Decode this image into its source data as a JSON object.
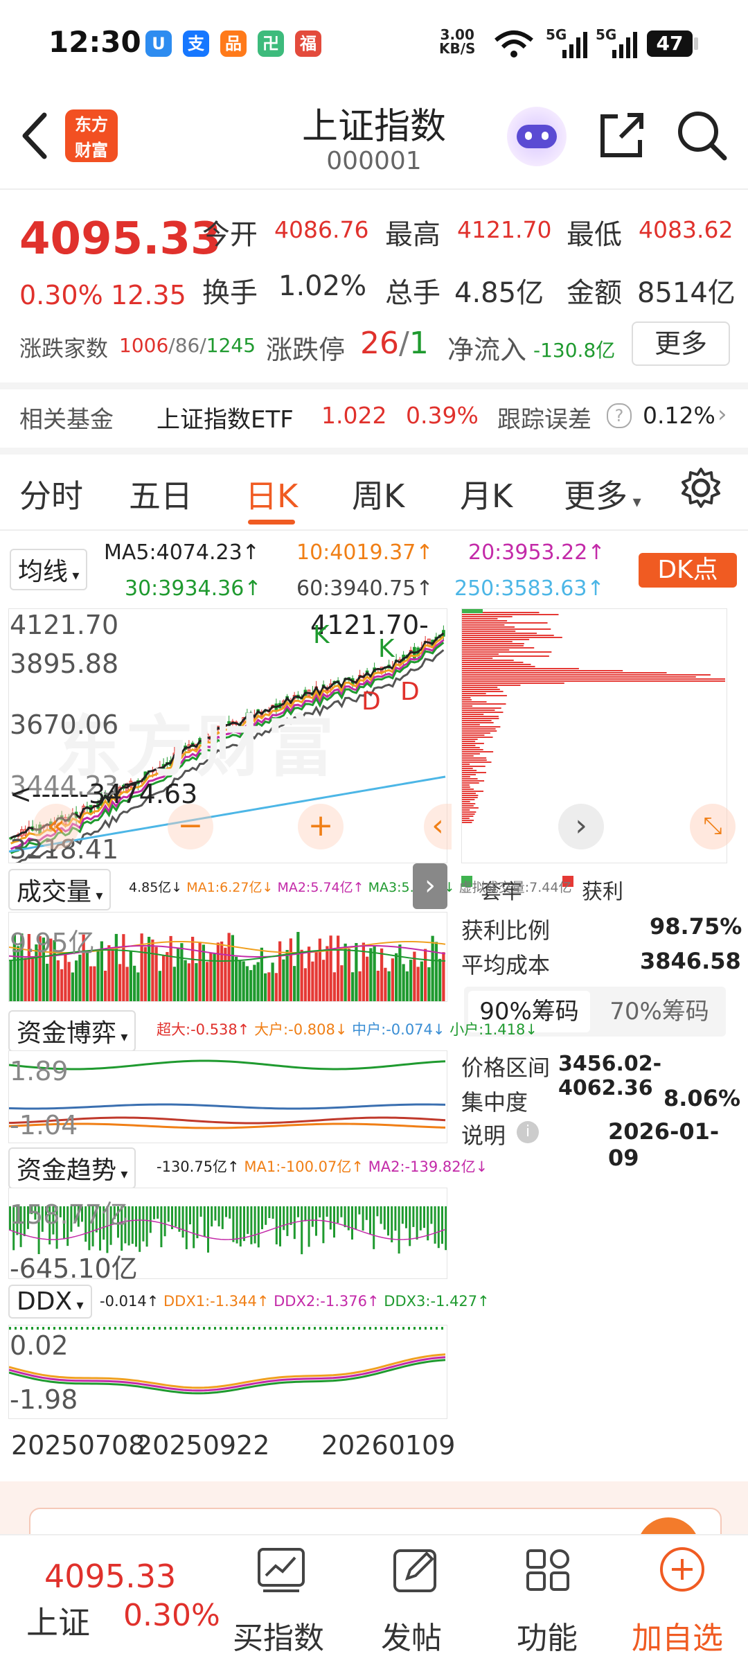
{
  "status": {
    "time": "12:30",
    "net_speed": "3.00\nKB/S",
    "signal": [
      "5G",
      "5G"
    ],
    "battery": "47",
    "apps": [
      {
        "icon": "app-blue-icon",
        "glyph": "U",
        "color": "#2d8cf0"
      },
      {
        "icon": "alipay-icon",
        "glyph": "支",
        "color": "#1677ff"
      },
      {
        "icon": "orange-app-icon",
        "glyph": "品",
        "color": "#ff7a1a"
      },
      {
        "icon": "green-app-icon",
        "glyph": "卍",
        "color": "#3dbb7c"
      },
      {
        "icon": "red-app-icon",
        "glyph": "福",
        "color": "#e34b3c"
      }
    ]
  },
  "header": {
    "title": "上证指数",
    "code": "000001",
    "logo_line1": "东方",
    "logo_line2": "财富"
  },
  "quote": {
    "price": "4095.33",
    "change_pct": "0.30%",
    "change": "12.35",
    "open_label": "今开",
    "open": "4086.76",
    "high_label": "最高",
    "high": "4121.70",
    "low_label": "最低",
    "low": "4083.62",
    "turnover_label": "换手",
    "turnover": "1.02%",
    "volume_label": "总手",
    "volume": "4.85亿",
    "amount_label": "金额",
    "amount": "8514亿",
    "breadth_label": "涨跌家数",
    "breadth_up": "1006",
    "breadth_flat": "86",
    "breadth_down": "1245",
    "limit_label": "涨跌停",
    "limit_up": "26",
    "limit_down": "1",
    "inflow_label": "净流入",
    "inflow": "-130.8亿",
    "more": "更多"
  },
  "fund": {
    "label": "相关基金",
    "name": "上证指数ETF",
    "price": "1.022",
    "pct": "0.39%",
    "tracking_label": "跟踪误差",
    "tracking": "0.12%"
  },
  "tabs": [
    "分时",
    "五日",
    "日K",
    "周K",
    "月K",
    "更多"
  ],
  "active_tab": 2,
  "ma": {
    "selector": "均线",
    "ma5": "MA5:4074.23↑",
    "ma10": "10:4019.37↑",
    "ma20": "20:3953.22↑",
    "ma30": "30:3934.36↑",
    "ma60": "60:3940.75↑",
    "ma250": "250:3583.63↑",
    "dk": "DK点"
  },
  "kline": {
    "price_top": "4121.70",
    "price_2": "3895.88",
    "price_3": "3670.06",
    "price_4": "3444.23",
    "price_bottom": "3218.41",
    "max_label": "4121.70",
    "min_label": "3474.63",
    "markers": [
      "K",
      "K",
      "D",
      "D"
    ],
    "watermark": "东方财富"
  },
  "volume": {
    "selector": "成交量",
    "info": [
      "4.85亿↓",
      "MA1:6.27亿↓",
      "MA2:5.74亿↑",
      "MA3:5.43亿↓",
      "虚拟成交量:7.44亿"
    ],
    "scale": "9.95亿"
  },
  "fund_game": {
    "selector": "资金博弈",
    "info": [
      "超大:-0.538↑",
      "大户:-0.808↓",
      "中户:-0.074↓",
      "小户:1.418↓"
    ],
    "top": "1.89",
    "bottom": "-1.04"
  },
  "fund_trend": {
    "selector": "资金趋势",
    "info": [
      "-130.75亿↑",
      "MA1:-100.07亿↑",
      "MA2:-139.82亿↓"
    ],
    "top": "158.77亿",
    "bottom": "-645.10亿"
  },
  "ddx": {
    "selector": "DDX",
    "info": [
      "-0.014↑",
      "DDX1:-1.344↑",
      "DDX2:-1.376↑",
      "DDX3:-1.427↑"
    ],
    "top": "0.02",
    "bottom": "-1.98"
  },
  "dates": [
    "20250708",
    "20250922",
    "20260109"
  ],
  "chips": {
    "legend_trapped": "套牢",
    "legend_profit": "获利",
    "profit_ratio_label": "获利比例",
    "profit_ratio": "98.75%",
    "avg_cost_label": "平均成本",
    "avg_cost": "3846.58",
    "tab90": "90%筹码",
    "tab70": "70%筹码",
    "range_label": "价格区间",
    "range": "3456.02-4062.36",
    "conc_label": "集中度",
    "conc": "8.06%",
    "note_label": "说明",
    "note": "2026-01-09"
  },
  "bottom": {
    "price": "4095.33",
    "name": "上证",
    "pct": "0.30%",
    "nav": [
      "买指数",
      "发帖",
      "功能",
      "加自选"
    ]
  }
}
